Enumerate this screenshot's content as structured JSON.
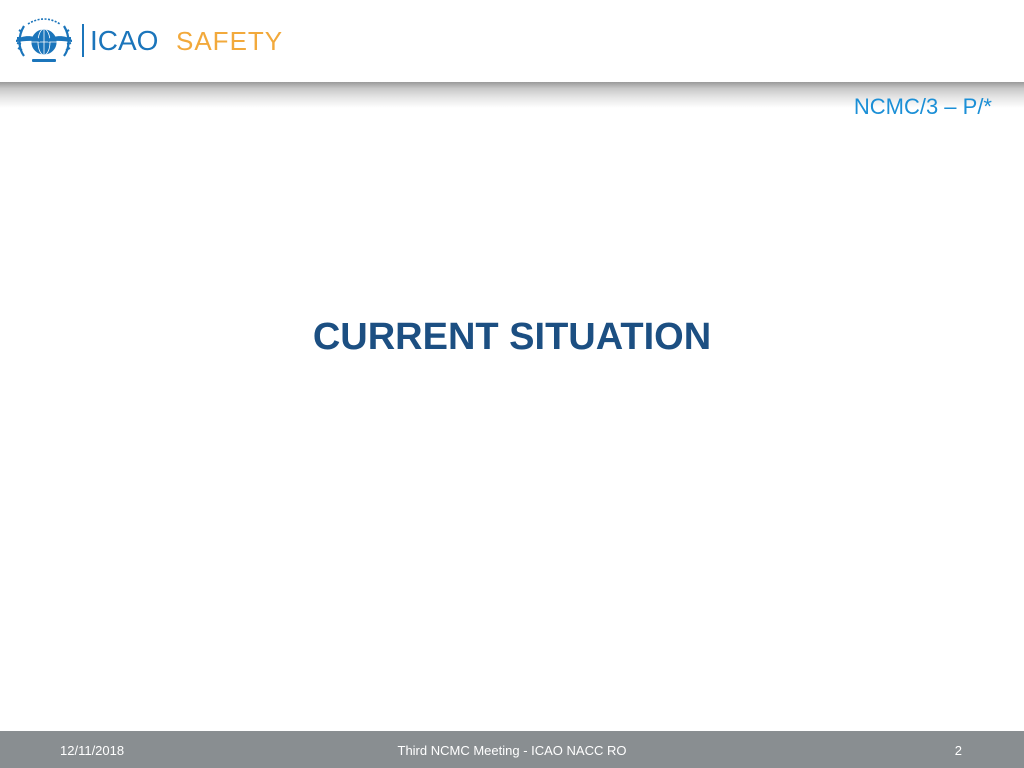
{
  "header": {
    "emblem_icon": "icao-emblem-icon",
    "brand_name": "ICAO",
    "brand_tagline": "SAFETY",
    "colors": {
      "brand_blue": "#1b75bb",
      "safety_orange": "#f2a93b"
    }
  },
  "slide": {
    "reference_code": "NCMC/3 – P/*",
    "title": "CURRENT SITUATION",
    "colors": {
      "title": "#1c4f82",
      "reference": "#1b8fd6"
    }
  },
  "footer": {
    "date": "12/11/2018",
    "meeting": "Third NCMC Meeting - ICAO NACC RO",
    "page_number": "2",
    "colors": {
      "background": "#898e91"
    }
  }
}
